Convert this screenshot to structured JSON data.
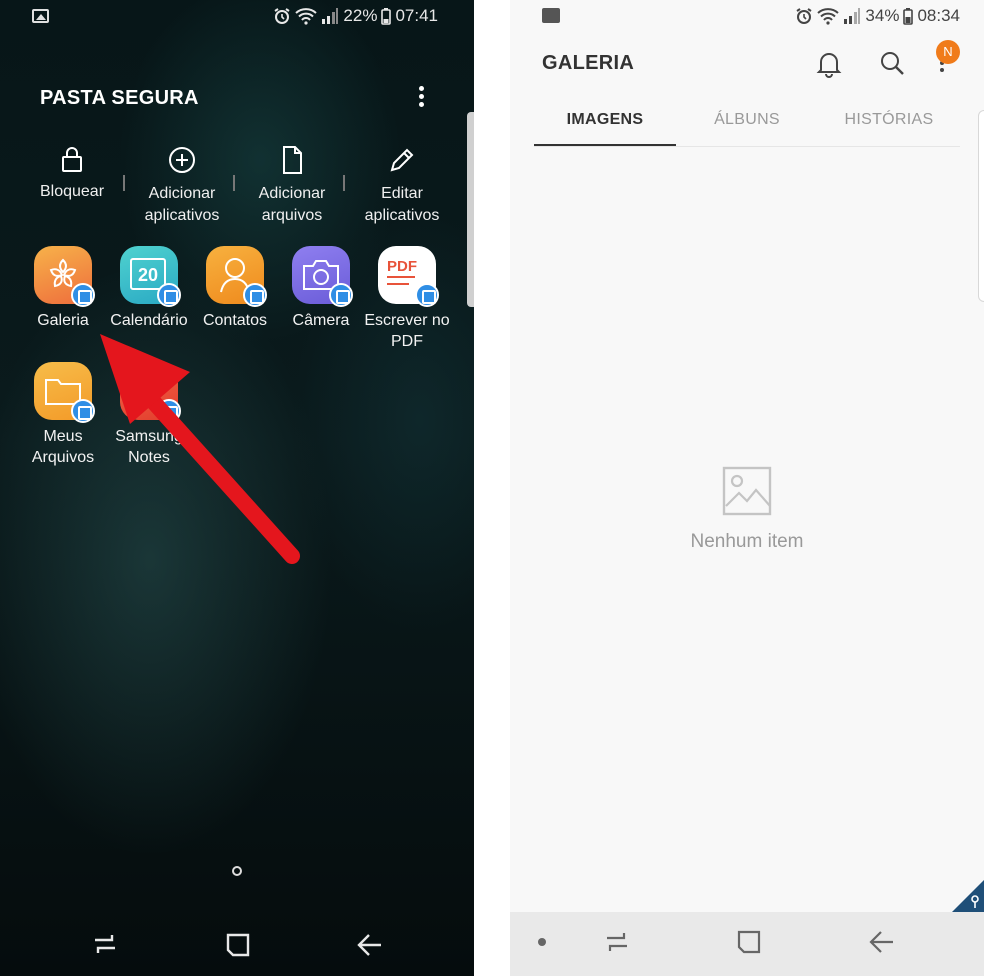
{
  "left": {
    "status": {
      "battery": "22%",
      "time": "07:41"
    },
    "title": "PASTA SEGURA",
    "actions": [
      {
        "label": "Bloquear",
        "icon": "lock-icon"
      },
      {
        "label": "Adicionar aplicativos",
        "icon": "add-circle-icon"
      },
      {
        "label": "Adicionar arquivos",
        "icon": "file-icon"
      },
      {
        "label": "Editar aplicativos",
        "icon": "pencil-icon"
      }
    ],
    "apps": [
      {
        "label": "Galeria"
      },
      {
        "label": "Calendário",
        "day": "20"
      },
      {
        "label": "Contatos"
      },
      {
        "label": "Câmera"
      },
      {
        "label": "Escrever no PDF",
        "pdf": "PDF"
      },
      {
        "label": "Meus Arquivos"
      },
      {
        "label": "Samsung Notes"
      }
    ]
  },
  "right": {
    "status": {
      "battery": "34%",
      "time": "08:34"
    },
    "title": "GALERIA",
    "badge": "N",
    "tabs": [
      {
        "label": "IMAGENS",
        "active": true
      },
      {
        "label": "ÁLBUNS",
        "active": false
      },
      {
        "label": "HISTÓRIAS",
        "active": false
      }
    ],
    "empty_text": "Nenhum item"
  },
  "colors": {
    "arrow": "#e4161d",
    "galeria": "#f29a36",
    "calendario": "#3fc1c9",
    "contatos": "#f39b2b",
    "camera": "#7d6fe0",
    "pdf_accent": "#e8533a",
    "arquivos": "#f3a532",
    "notes": "#e8503d",
    "badge": "#f07b1a",
    "lock_badge": "#2f8ee5"
  }
}
